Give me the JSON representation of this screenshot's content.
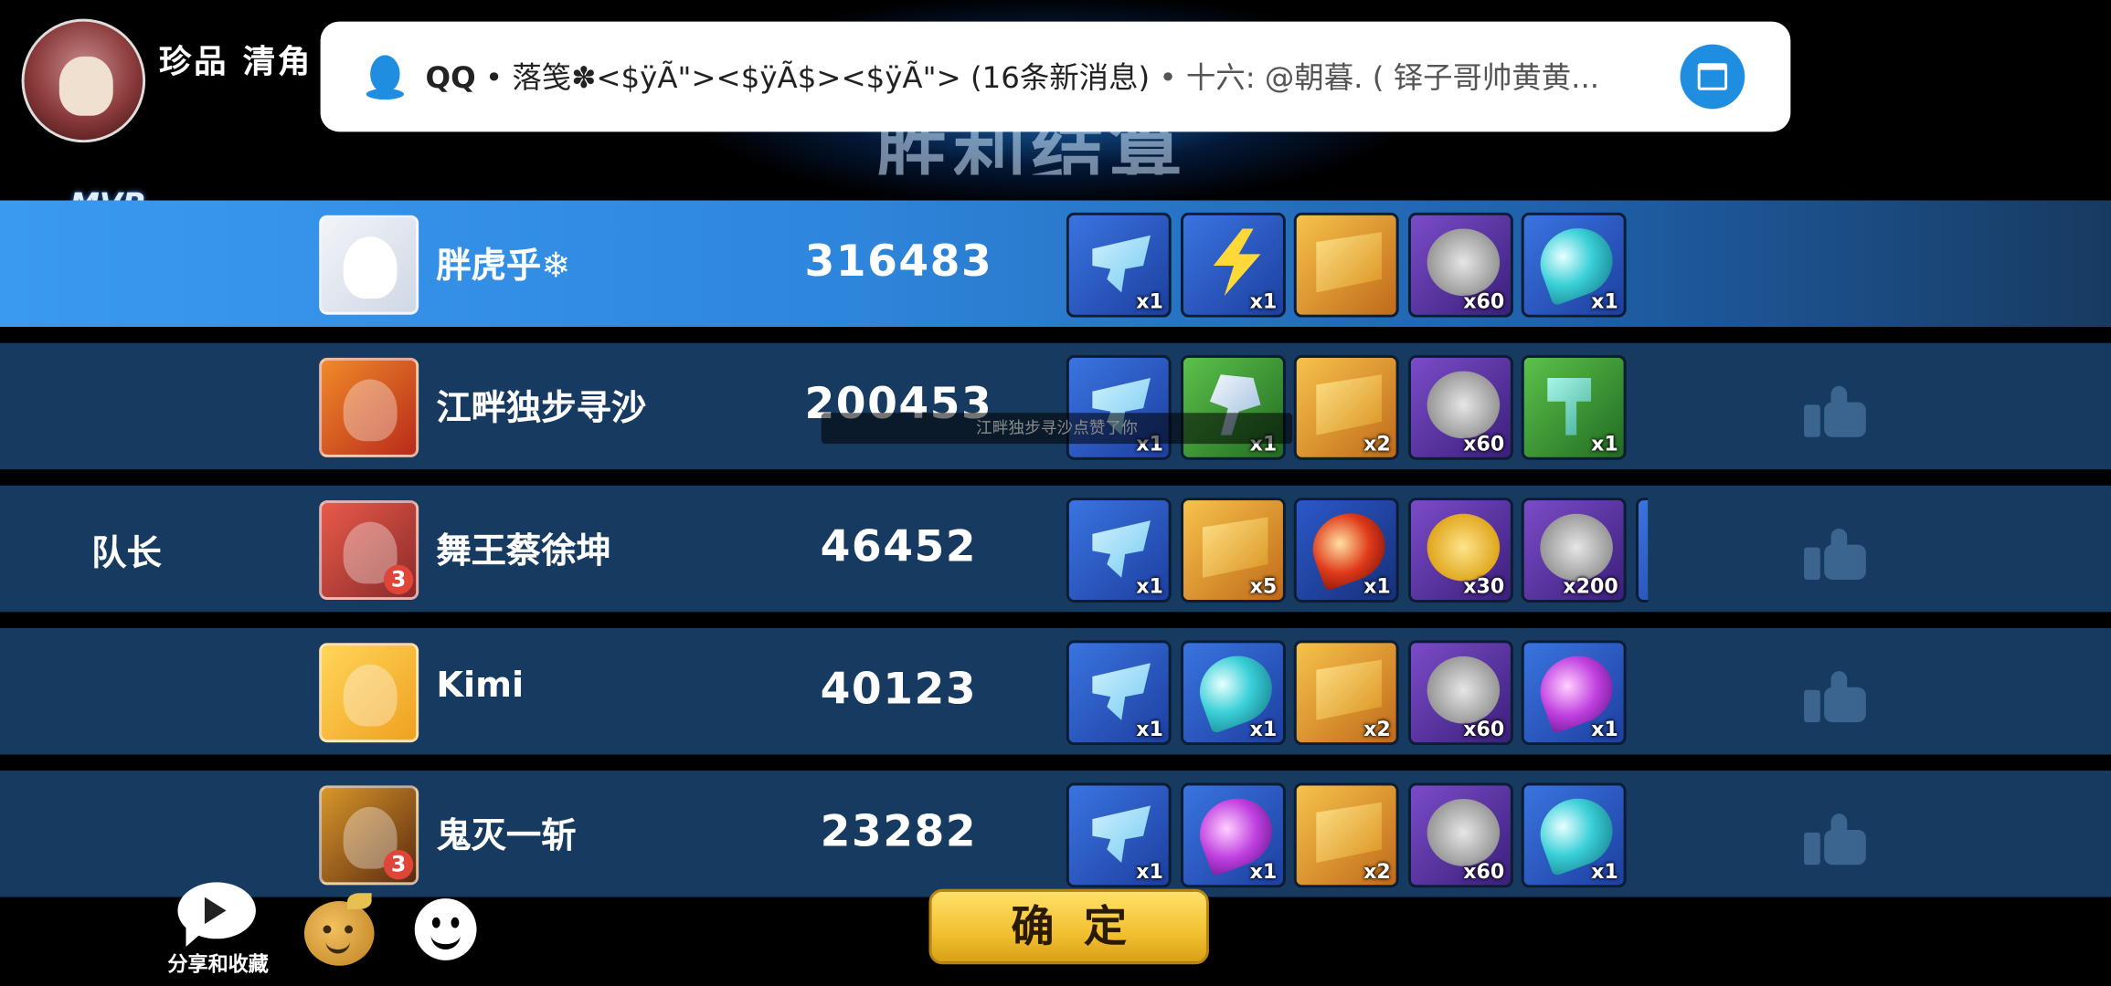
{
  "header": {
    "player_name": "珍品 清角",
    "mvp_label": "MVP",
    "title_banner": "胜利结算"
  },
  "notification": {
    "app": "QQ",
    "text": "落笺✽<$ÿÃ\"><$ÿÃ$><$ÿÃ\"> (16条新消息)",
    "preview": "十六: @朝暮. ( 铎子哥帅黄黄..."
  },
  "rows": [
    {
      "role": "",
      "name": "胖虎乎❄",
      "score": "316483",
      "mvp": true,
      "items": [
        {
          "icon": "ticket-icon",
          "color": "blue",
          "qty": "x1"
        },
        {
          "icon": "bolt-icon",
          "color": "blue",
          "qty": "x1"
        },
        {
          "icon": "coupon-icon",
          "color": "gold",
          "qty": ""
        },
        {
          "icon": "silver-coin-icon",
          "color": "purple",
          "qty": "x60"
        },
        {
          "icon": "cyan-gem-icon",
          "color": "blue",
          "qty": "x1"
        }
      ]
    },
    {
      "role": "",
      "name": "江畔独步寻沙",
      "score": "200453",
      "mvp": false,
      "items": [
        {
          "icon": "ticket-icon",
          "color": "blue",
          "qty": "x1"
        },
        {
          "icon": "crystal-icon",
          "color": "green",
          "qty": "x1"
        },
        {
          "icon": "coupon-icon",
          "color": "gold",
          "qty": "x2"
        },
        {
          "icon": "silver-coin-icon",
          "color": "purple",
          "qty": "x60"
        },
        {
          "icon": "hammer-icon",
          "color": "green",
          "qty": "x1"
        }
      ]
    },
    {
      "role": "队长",
      "name": "舞王蔡徐坤",
      "score": "46452",
      "mvp": false,
      "items": [
        {
          "icon": "ticket-icon",
          "color": "blue",
          "qty": "x1"
        },
        {
          "icon": "coupon-icon",
          "color": "gold",
          "qty": "x5"
        },
        {
          "icon": "red-gem-icon",
          "color": "red",
          "qty": "x1"
        },
        {
          "icon": "gold-coin-icon",
          "color": "purple",
          "qty": "x30"
        },
        {
          "icon": "silver-coin-icon",
          "color": "purple",
          "qty": "x200"
        },
        {
          "icon": "extra-item-icon",
          "color": "blue",
          "qty": ""
        }
      ]
    },
    {
      "role": "",
      "name": "Kimi",
      "score": "40123",
      "mvp": false,
      "items": [
        {
          "icon": "ticket-icon",
          "color": "blue",
          "qty": "x1"
        },
        {
          "icon": "cyan-gem-icon",
          "color": "blue",
          "qty": "x1"
        },
        {
          "icon": "coupon-icon",
          "color": "gold",
          "qty": "x2"
        },
        {
          "icon": "silver-coin-icon",
          "color": "purple",
          "qty": "x60"
        },
        {
          "icon": "purple-gem-icon",
          "color": "blue",
          "qty": "x1"
        }
      ]
    },
    {
      "role": "",
      "name": "鬼灭一斩",
      "score": "23282",
      "mvp": false,
      "items": [
        {
          "icon": "ticket-icon",
          "color": "blue",
          "qty": "x1"
        },
        {
          "icon": "purple-gem-icon",
          "color": "blue",
          "qty": "x1"
        },
        {
          "icon": "coupon-icon",
          "color": "gold",
          "qty": "x2"
        },
        {
          "icon": "silver-coin-icon",
          "color": "purple",
          "qty": "x60"
        },
        {
          "icon": "cyan-gem-icon",
          "color": "blue",
          "qty": "x1"
        }
      ]
    }
  ],
  "toast": "江畔独步寻沙点赞了你",
  "footer": {
    "share_label": "分享和收藏",
    "confirm_label": "确定"
  },
  "colors": {
    "row_bg": "#173a60",
    "mvp_row": "#3a9af0",
    "confirm_gold": "#f2c030",
    "notif_accent": "#1f8ee0"
  }
}
